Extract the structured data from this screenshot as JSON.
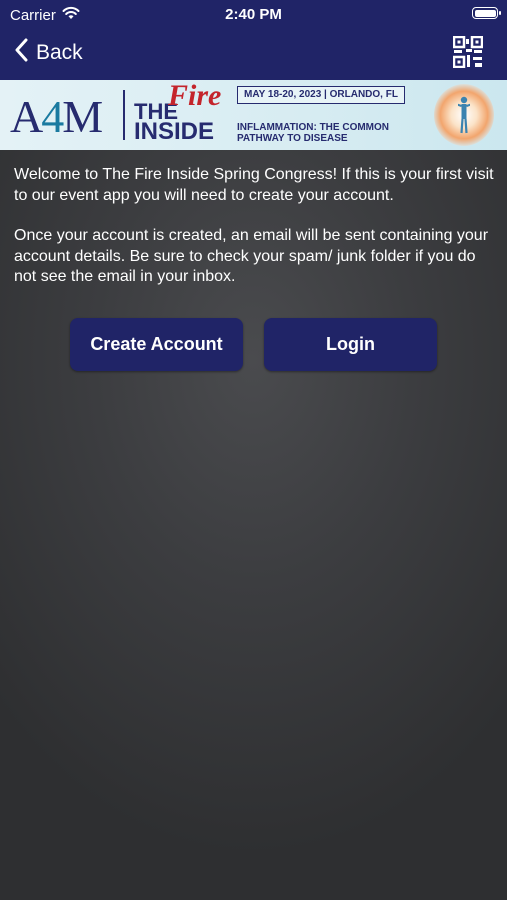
{
  "status_bar": {
    "carrier": "Carrier",
    "time": "2:40 PM"
  },
  "nav": {
    "back_label": "Back",
    "qr_icon": "qr-code-icon"
  },
  "banner": {
    "logo_a": "A",
    "logo_4": "4",
    "logo_m": "M",
    "the": "THE",
    "fire": "Fire",
    "inside": "INSIDE",
    "dates": "MAY 18-20, 2023 | ORLANDO, FL",
    "tagline_line1": "INFLAMMATION: THE COMMON",
    "tagline_line2": "PATHWAY TO DISEASE"
  },
  "content": {
    "paragraph1": "Welcome to The Fire Inside Spring Congress! If this is your first visit to our event app you will need to create your account.",
    "paragraph2": "Once your account is created, an email will be sent containing your account details. Be sure to check your spam/ junk folder if you do not see the email in your inbox."
  },
  "buttons": {
    "create_account": "Create Account",
    "login": "Login"
  },
  "colors": {
    "nav_bar": "#202467",
    "button": "#202467",
    "background": "#3c3d40",
    "brand_blue": "#262b6f",
    "fire_red": "#c4242b"
  }
}
